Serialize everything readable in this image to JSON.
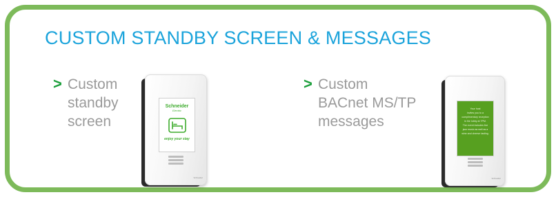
{
  "title": "CUSTOM STANDBY SCREEN & MESSAGES",
  "bullet_marker": ">",
  "features": [
    {
      "lines": [
        "Custom",
        "standby",
        "screen"
      ]
    },
    {
      "lines": [
        "Custom",
        "BACnet MS/TP",
        "messages"
      ]
    }
  ],
  "device_standby": {
    "logo": "Schneider",
    "logo_sub": "Electric",
    "caption": "enjoy your stay",
    "icon": "bed-icon",
    "brand": "Schneider"
  },
  "device_message": {
    "message": "Your host\ninvites you to a\ncomplimentary reception\nin the lobby at 7PM.\nThe event includes live\njazz music as well as a\nwine and cheese tasting.",
    "brand": "Schneider"
  },
  "colors": {
    "frame": "#7dba5a",
    "title": "#1aa3db",
    "bullet_arrow": "#1a9e3a",
    "bullet_text": "#9a9a9a",
    "message_screen": "#57a020"
  }
}
